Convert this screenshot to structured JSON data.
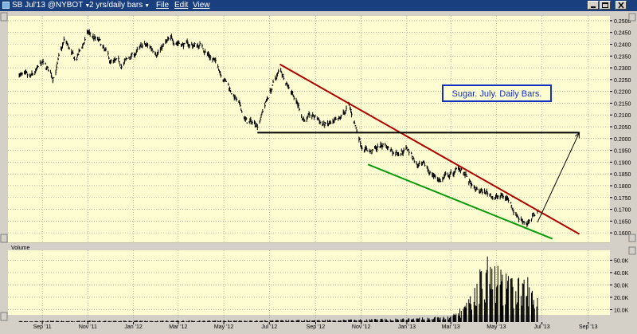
{
  "titlebar": {
    "symbol": "SB Jul'13 @NYBOT",
    "interval": "2 yrs/daily bars",
    "menu": [
      "File",
      "Edit",
      "View"
    ]
  },
  "annotation": "Sugar.  July.  Daily Bars.",
  "volume_label": "Volume",
  "colors": {
    "background": "#fefdd2",
    "price": "#000000",
    "upper_trendline": "#b00000",
    "lower_trendline": "#0a9a0a",
    "horizontal_line": "#000000",
    "annotation_border": "#1030c0",
    "annotation_text": "#1030c0",
    "titlebar": "#1a3f7e"
  },
  "chart_data": [
    {
      "type": "line",
      "title": "",
      "xlabel": "",
      "ylabel": "",
      "x_ticks": [
        "Sep '11",
        "Nov '11",
        "Jan '12",
        "Mar '12",
        "May '12",
        "Jul '12",
        "Sep '12",
        "Nov '12",
        "Jan '13",
        "Mar '13",
        "May '13",
        "Jul '13",
        "Sep '13"
      ],
      "y_ticks": [
        "0.2500",
        "0.2450",
        "0.2400",
        "0.2350",
        "0.2300",
        "0.2250",
        "0.2200",
        "0.2150",
        "0.2100",
        "0.2050",
        "0.2000",
        "0.1950",
        "0.1900",
        "0.1850",
        "0.1800",
        "0.1750",
        "0.1700",
        "0.1650",
        "0.1600"
      ],
      "ylim": [
        0.157,
        0.252
      ],
      "series": [
        {
          "points": [
            [
              "2011-08-01",
              0.2275
            ],
            [
              "2011-08-15",
              0.224
            ],
            [
              "2011-09-01",
              0.231
            ],
            [
              "2011-09-15",
              0.226
            ],
            [
              "2011-10-01",
              0.2415
            ],
            [
              "2011-10-15",
              0.232
            ],
            [
              "2011-11-01",
              0.2445
            ],
            [
              "2011-11-15",
              0.241
            ],
            [
              "2011-12-01",
              0.232
            ],
            [
              "2011-12-15",
              0.2305
            ],
            [
              "2012-01-01",
              0.2355
            ],
            [
              "2012-01-15",
              0.239
            ],
            [
              "2012-02-01",
              0.2375
            ],
            [
              "2012-02-15",
              0.2405
            ],
            [
              "2012-03-01",
              0.2415
            ],
            [
              "2012-03-15",
              0.2395
            ],
            [
              "2012-04-01",
              0.2395
            ],
            [
              "2012-04-15",
              0.2345
            ],
            [
              "2012-05-01",
              0.2265
            ],
            [
              "2012-05-15",
              0.218
            ],
            [
              "2012-06-01",
              0.2065
            ],
            [
              "2012-06-15",
              0.2065
            ],
            [
              "2012-07-01",
              0.2195
            ],
            [
              "2012-07-15",
              0.229
            ],
            [
              "2012-08-01",
              0.2205
            ],
            [
              "2012-08-15",
              0.209
            ],
            [
              "2012-09-01",
              0.2085
            ],
            [
              "2012-09-15",
              0.2055
            ],
            [
              "2012-10-01",
              0.2055
            ],
            [
              "2012-10-15",
              0.2135
            ],
            [
              "2012-11-01",
              0.198
            ],
            [
              "2012-11-15",
              0.1945
            ],
            [
              "2012-12-01",
              0.1975
            ],
            [
              "2012-12-15",
              0.1945
            ],
            [
              "2013-01-01",
              0.1965
            ],
            [
              "2013-01-15",
              0.189
            ],
            [
              "2013-02-01",
              0.1855
            ],
            [
              "2013-02-15",
              0.1825
            ],
            [
              "2013-03-01",
              0.1845
            ],
            [
              "2013-03-15",
              0.1875
            ],
            [
              "2013-04-01",
              0.1775
            ],
            [
              "2013-04-15",
              0.177
            ],
            [
              "2013-05-01",
              0.1755
            ],
            [
              "2013-05-15",
              0.175
            ],
            [
              "2013-06-01",
              0.1665
            ],
            [
              "2013-06-15",
              0.1645
            ],
            [
              "2013-06-25",
              0.1695
            ]
          ]
        }
      ],
      "trendlines": [
        {
          "name": "upper",
          "from": [
            "2012-07-15",
            0.2315
          ],
          "to": [
            "2013-08-20",
            0.1595
          ]
        },
        {
          "name": "lower",
          "from": [
            "2012-11-10",
            0.189
          ],
          "to": [
            "2013-07-15",
            0.1575
          ]
        },
        {
          "name": "horizontal",
          "from": [
            "2012-06-15",
            0.2025
          ],
          "to": [
            "2013-08-20",
            0.2025
          ]
        },
        {
          "name": "arrow",
          "from": [
            "2013-06-25",
            0.1645
          ],
          "to": [
            "2013-08-20",
            0.2025
          ]
        }
      ]
    },
    {
      "type": "bar",
      "title": "Volume",
      "y_ticks": [
        "50.0K",
        "40.0K",
        "30.0K",
        "20.0K",
        "10.0K"
      ],
      "ylim": [
        0,
        58000
      ],
      "volume_profile": [
        [
          "2011-08-01",
          800
        ],
        [
          "2012-06-01",
          1200
        ],
        [
          "2012-10-01",
          1600
        ],
        [
          "2013-01-01",
          2500
        ],
        [
          "2013-03-01",
          4000
        ],
        [
          "2013-03-25",
          15000
        ],
        [
          "2013-04-15",
          45000
        ],
        [
          "2013-05-01",
          40000
        ],
        [
          "2013-05-20",
          30000
        ],
        [
          "2013-06-10",
          32000
        ],
        [
          "2013-06-25",
          18000
        ]
      ]
    }
  ]
}
